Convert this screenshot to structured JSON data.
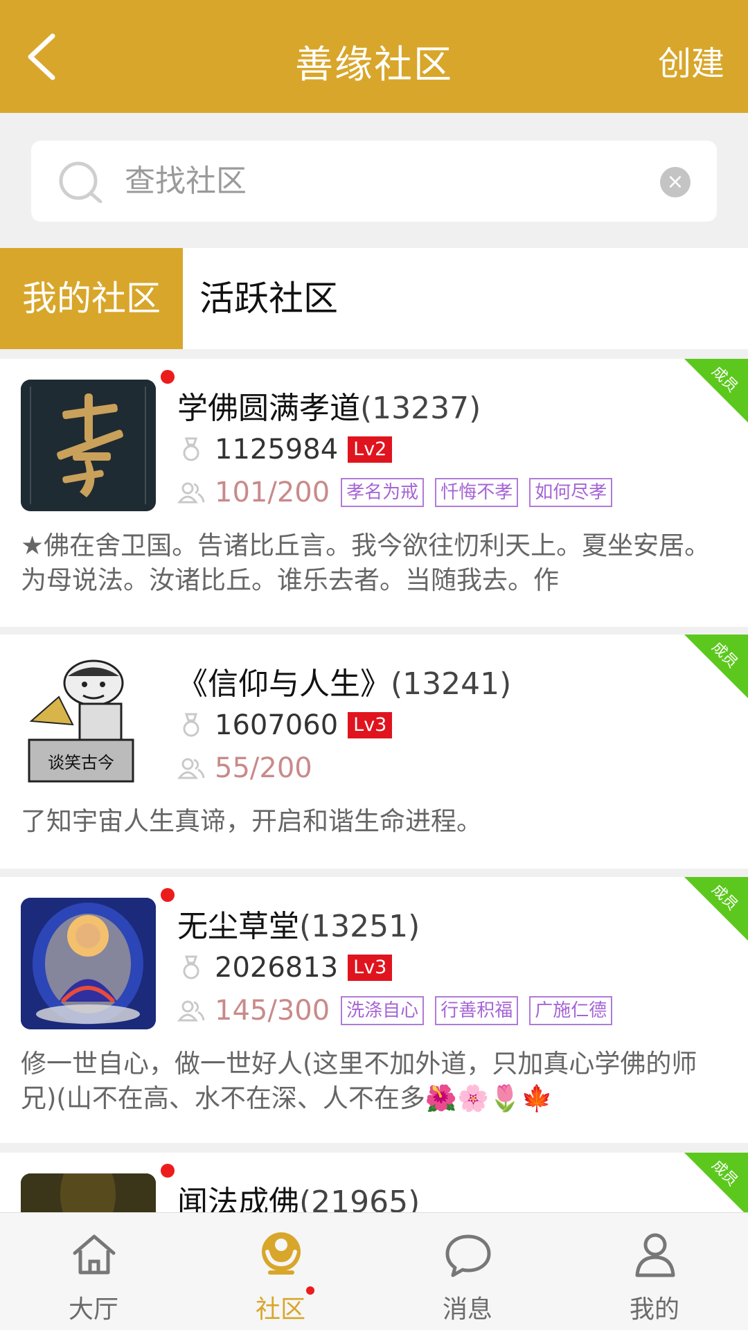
{
  "header": {
    "title": "善缘社区",
    "create_label": "创建"
  },
  "search": {
    "placeholder": "查找社区",
    "value": ""
  },
  "tabs": [
    {
      "label": "我的社区",
      "active": true
    },
    {
      "label": "活跃社区",
      "active": false
    }
  ],
  "colors": {
    "brand": "#d8a62a",
    "level_badge": "#e0141e",
    "tag_border": "#b07ad8",
    "corner_badge": "#5cc81e",
    "unread_dot": "#ec1c1c"
  },
  "communities": [
    {
      "name": "学佛圆满孝道",
      "count": "(13237)",
      "merit": "1125984",
      "level": "Lv2",
      "members": "101/200",
      "tags": [
        "孝名为戒",
        "忏悔不孝",
        "如何尽孝"
      ],
      "desc": "★佛在舍卫国。告诸比丘言。我今欲往忉利天上。夏坐安居。为母说法。汝诸比丘。谁乐去者。当随我去。作",
      "corner": "成员",
      "unread": true,
      "avatar_icon": "xiao-calligraphy-image"
    },
    {
      "name": "《信仰与人生》",
      "count": "(13241)",
      "merit": "1607060",
      "level": "Lv3",
      "members": "55/200",
      "tags": [],
      "desc": "了知宇宙人生真谛，开启和谐生命进程。",
      "corner": "成员",
      "unread": false,
      "avatar_text": "谈笑古今"
    },
    {
      "name": "无尘草堂",
      "count": "(13251)",
      "merit": "2026813",
      "level": "Lv3",
      "members": "145/300",
      "tags": [
        "洗涤自心",
        "行善积福",
        "广施仁德"
      ],
      "desc": "修一世自心，做一世好人(这里不加外道，只加真心学佛的师兄)(山不在高、水不在深、人不在多🌺🌸🌷🍁",
      "corner": "成员",
      "unread": true,
      "avatar_icon": "medicine-buddha-image"
    },
    {
      "name": "闻法成佛",
      "count": "(21965)",
      "corner": "成员",
      "unread": true
    }
  ],
  "nav": [
    {
      "label": "大厅",
      "icon": "home-icon",
      "active": false
    },
    {
      "label": "社区",
      "icon": "community-icon",
      "active": true
    },
    {
      "label": "消息",
      "icon": "message-icon",
      "active": false
    },
    {
      "label": "我的",
      "icon": "profile-icon",
      "active": false
    }
  ]
}
